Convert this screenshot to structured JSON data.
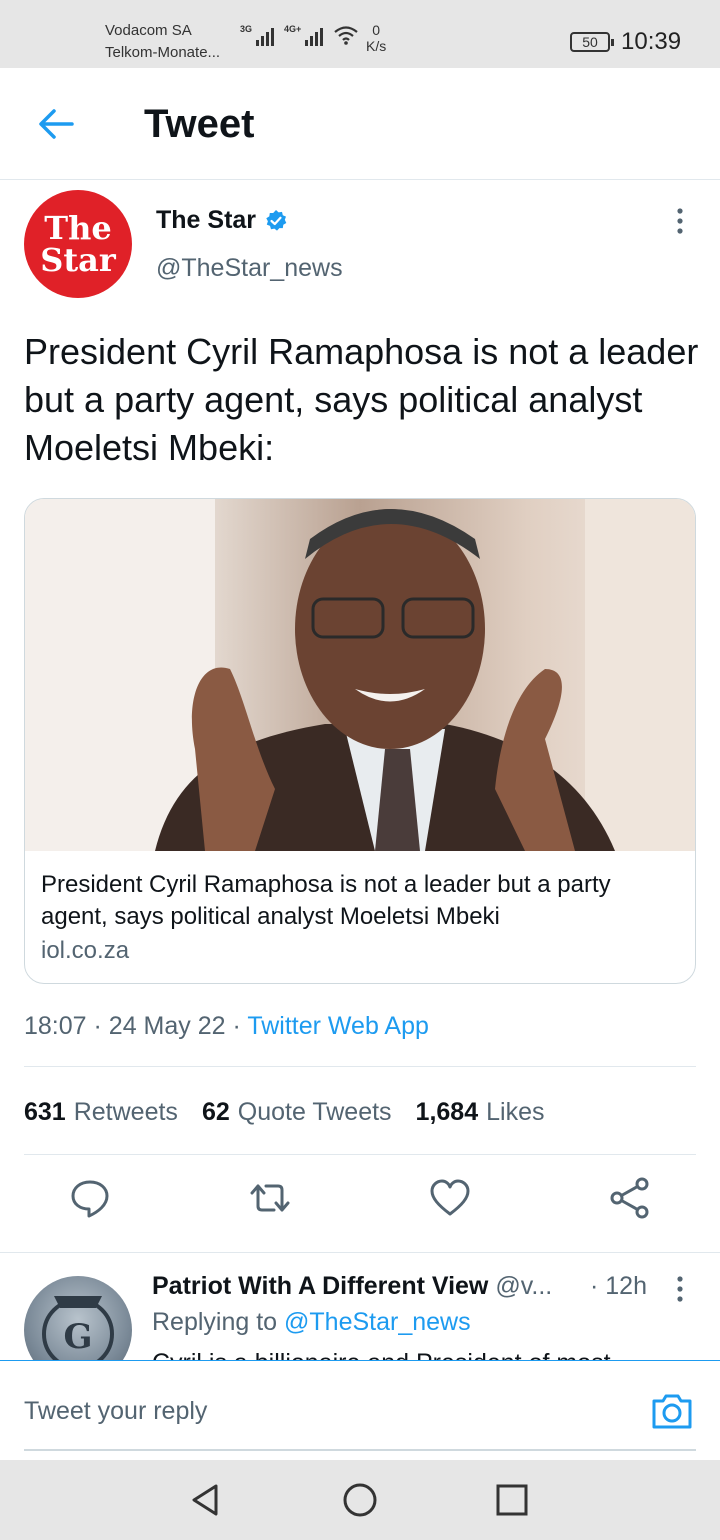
{
  "status_bar": {
    "carrier_1": "Vodacom SA",
    "carrier_2": "Telkom-Monate...",
    "signal_1_tag": "3G",
    "signal_2_tag": "4G+",
    "speed_value": "0",
    "speed_unit": "K/s",
    "battery": "50",
    "time": "10:39"
  },
  "header": {
    "title": "Tweet"
  },
  "tweet": {
    "avatar_text_1": "The",
    "avatar_text_2": "Star",
    "author_name": "The Star",
    "author_handle": "@TheStar_news",
    "text": "President Cyril Ramaphosa is not a leader but a party agent, says political analyst Moeletsi Mbeki:",
    "card": {
      "title": "President Cyril Ramaphosa is not a leader but a party agent, says political analyst Moeletsi Mbeki",
      "domain": "iol.co.za"
    },
    "time": "18:07",
    "date": "24 May 22",
    "source": "Twitter Web App",
    "stats": {
      "retweets_count": "631",
      "retweets_label": "Retweets",
      "quotes_count": "62",
      "quotes_label": "Quote Tweets",
      "likes_count": "1,684",
      "likes_label": "Likes"
    }
  },
  "reply": {
    "name": "Patriot With A Different View",
    "handle": "@v...",
    "time": "12h",
    "replying_label": "Replying to",
    "replying_handle": "@TheStar_news",
    "preview": "Cyril is a billionaire and President of most"
  },
  "compose": {
    "placeholder": "Tweet your reply"
  },
  "colors": {
    "accent": "#1d9bf0",
    "brand_red": "#e02128",
    "muted": "#536471"
  },
  "icons": [
    "back-arrow-icon",
    "verified-badge-icon",
    "more-vertical-icon",
    "reply-icon",
    "retweet-icon",
    "like-icon",
    "share-icon",
    "camera-icon",
    "nav-back-icon",
    "nav-home-icon",
    "nav-recents-icon"
  ]
}
